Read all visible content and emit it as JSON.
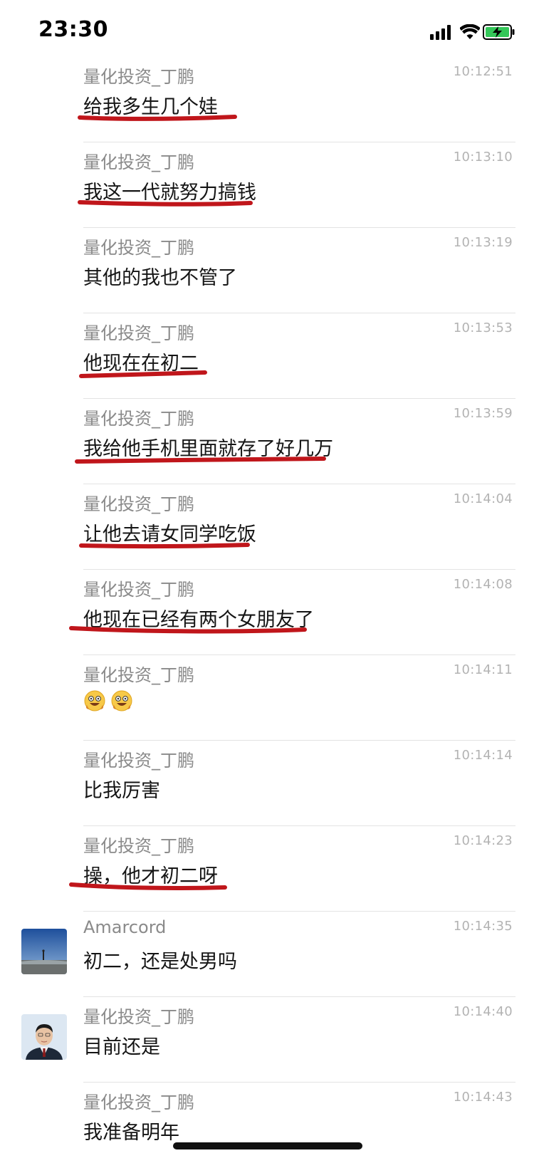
{
  "status": {
    "time": "23:30"
  },
  "messages": [
    {
      "sender": "量化投资_丁鹏",
      "time": "10:12:51",
      "text": "给我多生几个娃"
    },
    {
      "sender": "量化投资_丁鹏",
      "time": "10:13:10",
      "text": "我这一代就努力搞钱"
    },
    {
      "sender": "量化投资_丁鹏",
      "time": "10:13:19",
      "text": "其他的我也不管了"
    },
    {
      "sender": "量化投资_丁鹏",
      "time": "10:13:53",
      "text": "他现在在初二"
    },
    {
      "sender": "量化投资_丁鹏",
      "time": "10:13:59",
      "text": "我给他手机里面就存了好几万"
    },
    {
      "sender": "量化投资_丁鹏",
      "time": "10:14:04",
      "text": "让他去请女同学吃饭"
    },
    {
      "sender": "量化投资_丁鹏",
      "time": "10:14:08",
      "text": "他现在已经有两个女朋友了"
    },
    {
      "sender": "量化投资_丁鹏",
      "time": "10:14:11",
      "text": ""
    },
    {
      "sender": "量化投资_丁鹏",
      "time": "10:14:14",
      "text": "比我厉害"
    },
    {
      "sender": "量化投资_丁鹏",
      "time": "10:14:23",
      "text": "操，他才初二呀"
    },
    {
      "sender": "Amarcord",
      "time": "10:14:35",
      "text": "初二，还是处男吗"
    },
    {
      "sender": "量化投资_丁鹏",
      "time": "10:14:40",
      "text": "目前还是"
    },
    {
      "sender": "量化投资_丁鹏",
      "time": "10:14:43",
      "text": "我准备明年"
    }
  ],
  "icons": {
    "signal": "signal-icon",
    "wifi": "wifi-icon",
    "battery": "battery-charging-icon",
    "emoji": "grinning-face-emoji-icon"
  },
  "colors": {
    "underline": "#c0161b",
    "sender": "#8a8a8a",
    "time": "#b3b3b3",
    "divider": "#e3e3e3"
  }
}
